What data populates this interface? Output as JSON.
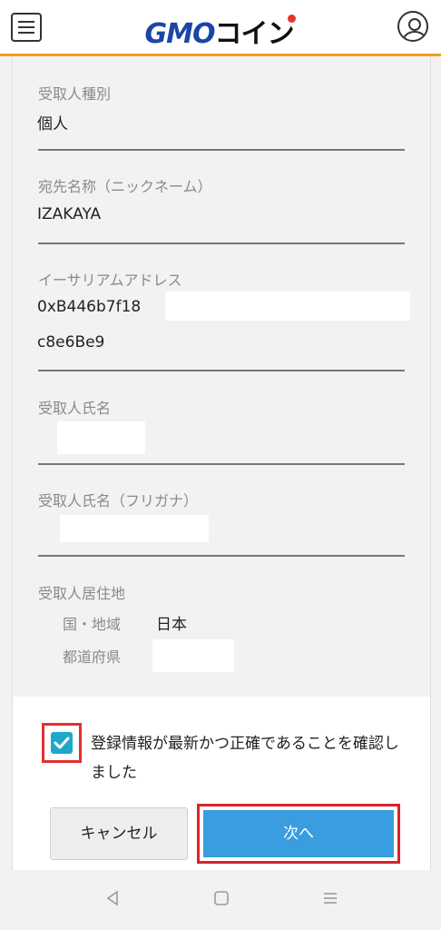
{
  "header": {
    "logo_gmo": "GMO",
    "logo_coin": "コイン",
    "menu_icon": "hamburger-menu-icon",
    "account_icon": "user-account-icon"
  },
  "fields": {
    "recipient_type": {
      "label": "受取人種別",
      "value": "個人"
    },
    "nickname": {
      "label": "宛先名称（ニックネーム）",
      "value": "IZAKAYA"
    },
    "eth_address": {
      "label": "イーサリアムアドレス",
      "line1": "0xB446b7f18",
      "line2": "c8e6Be9"
    },
    "recipient_name": {
      "label": "受取人氏名"
    },
    "recipient_name_kana": {
      "label": "受取人氏名（フリガナ）"
    },
    "recipient_residence": {
      "label": "受取人居住地",
      "country_label": "国・地域",
      "country_value": "日本",
      "prefecture_label": "都道府県"
    }
  },
  "footer": {
    "agree_text": "登録情報が最新かつ正確であることを確認しました",
    "agree_checked": true,
    "cancel_label": "キャンセル",
    "next_label": "次へ"
  },
  "colors": {
    "accent_orange": "#f0a020",
    "brand_blue": "#1a46a8",
    "checkbox_teal": "#1fa8c9",
    "next_button": "#3a9de0",
    "highlight_red": "#e03030"
  },
  "navbar": {
    "back_icon": "back-triangle-icon",
    "home_icon": "home-square-icon",
    "recents_icon": "recents-lines-icon"
  }
}
